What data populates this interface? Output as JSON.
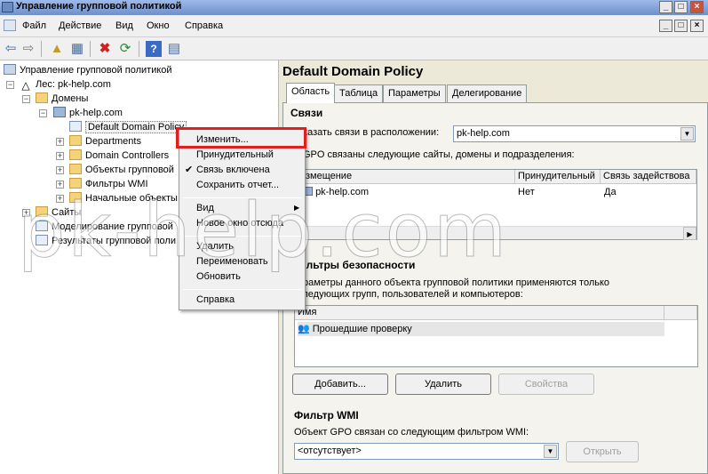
{
  "window": {
    "title": "Управление групповой политикой",
    "controls": [
      "_",
      "□",
      "×"
    ],
    "mdi_controls": [
      "_",
      "□",
      "×"
    ]
  },
  "menu": [
    "Файл",
    "Действие",
    "Вид",
    "Окно",
    "Справка"
  ],
  "tree": {
    "root": "Управление групповой политикой",
    "forest": "Лес: pk-help.com",
    "domains": "Домены",
    "domain": "pk-help.com",
    "selected": "Default Domain Policy",
    "children": [
      "Departments",
      "Domain Controllers",
      "Объекты групповой",
      "Фильтры WMI",
      "Начальные объекты"
    ],
    "sites": "Сайты",
    "modeling": "Моделирование групповой",
    "results": "Результаты групповой поли"
  },
  "context_menu": {
    "items": [
      "Изменить...",
      "Принудительный",
      "Связь включена",
      "Сохранить отчет..."
    ],
    "items2": [
      "Вид",
      "Новое окно отсюда"
    ],
    "items3": [
      "Удалить",
      "Переименовать",
      "Обновить"
    ],
    "items4": [
      "Справка"
    ]
  },
  "right": {
    "title": "Default Domain Policy",
    "tabs": [
      "Область",
      "Таблица",
      "Параметры",
      "Делегирование"
    ],
    "links": {
      "heading": "Связи",
      "location_label": "Показать связи в расположении:",
      "location_value": "pk-help.com",
      "desc": "GPO связаны следующие сайты, домены и подразделения:",
      "columns": [
        "Размещение",
        "Принудительный",
        "Связь задействова"
      ],
      "rows": [
        [
          "pk-help.com",
          "Нет",
          "Да"
        ]
      ]
    },
    "security": {
      "heading": "Фильтры безопасности",
      "desc1": "Параметры данного объекта групповой политики применяются только",
      "desc2": "к следующих групп, пользователей и компьютеров:",
      "column": "Имя",
      "rows": [
        "Прошедшие проверку"
      ],
      "buttons": [
        "Добавить...",
        "Удалить",
        "Свойства"
      ]
    },
    "wmi": {
      "heading": "Фильтр WMI",
      "label": "Объект GPO связан со следующим фильтром WMI:",
      "value": "<отсутствует>",
      "button": "Открыть"
    }
  },
  "watermark": "pk-help.com"
}
